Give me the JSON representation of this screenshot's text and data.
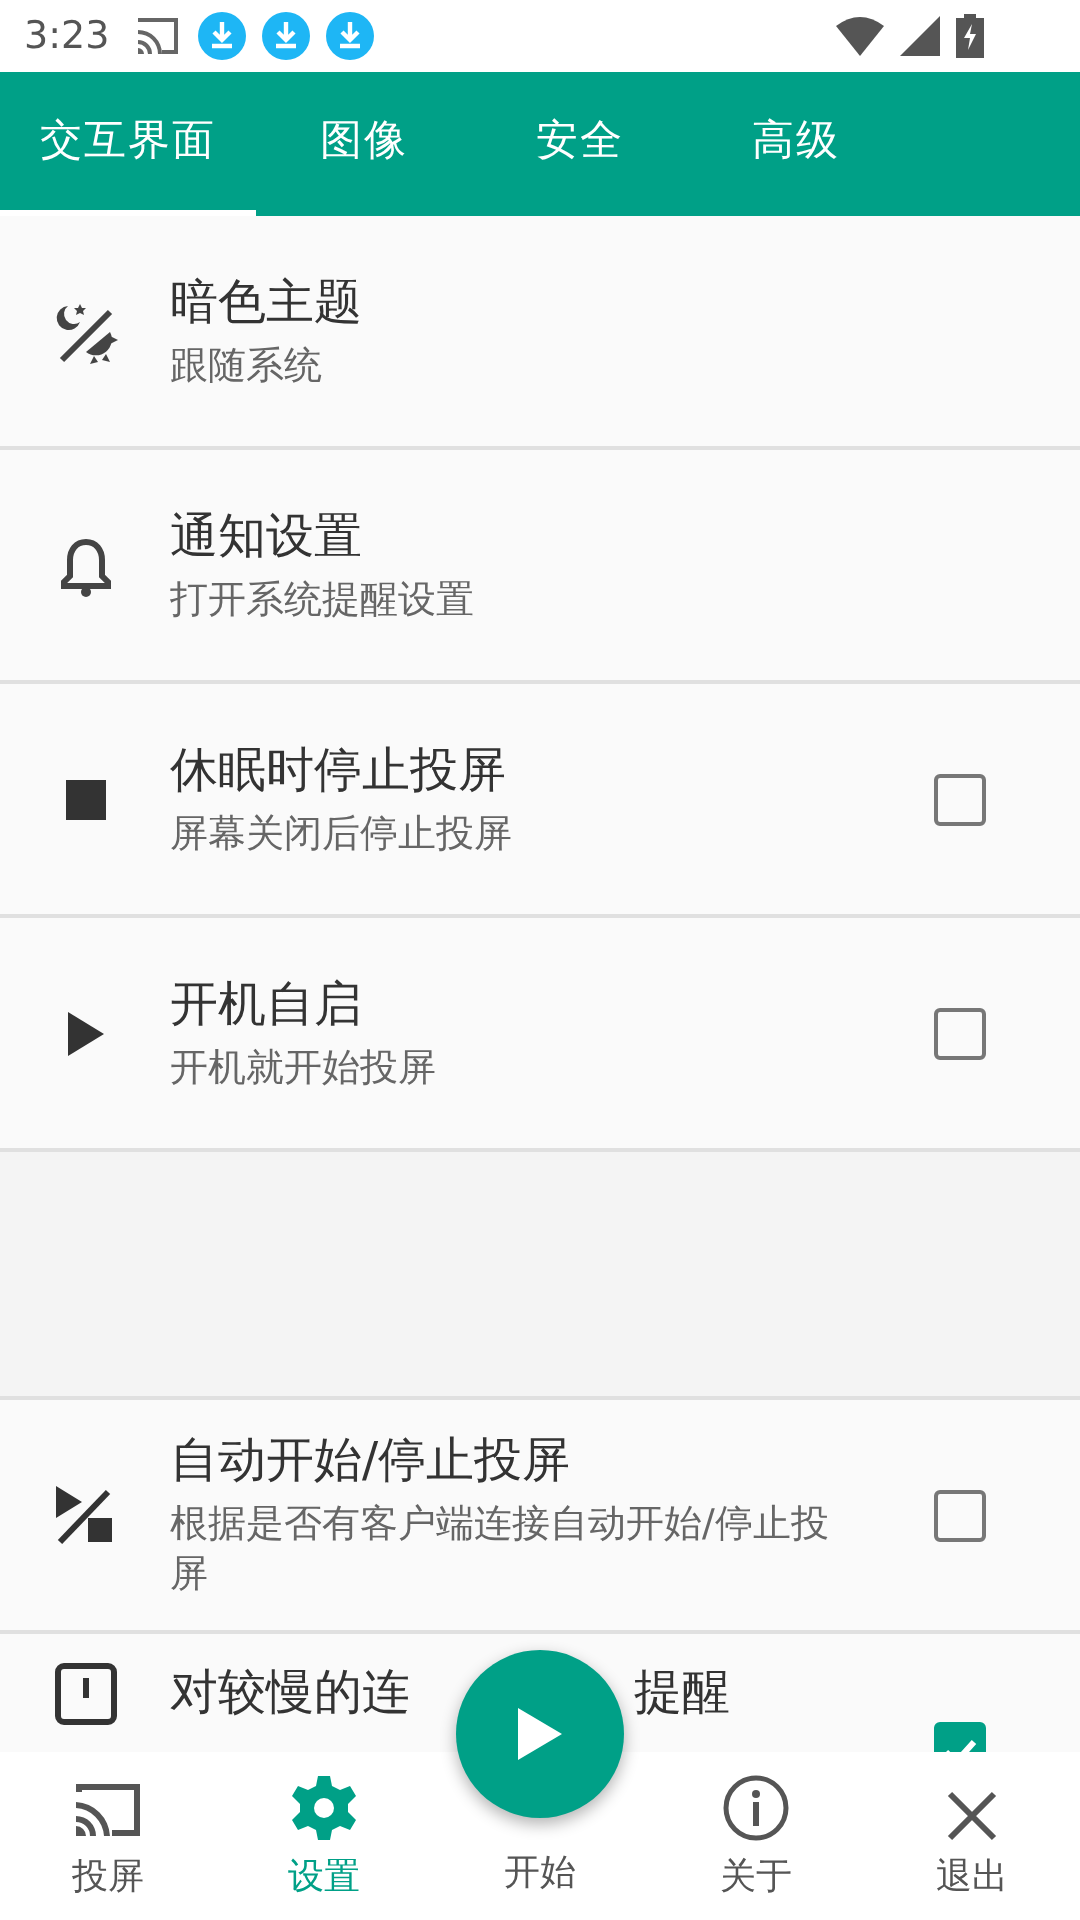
{
  "status_bar": {
    "time": "3:23"
  },
  "tabs": [
    {
      "label": "交互界面",
      "selected": true
    },
    {
      "label": "图像",
      "selected": false
    },
    {
      "label": "安全",
      "selected": false
    },
    {
      "label": "高级",
      "selected": false
    }
  ],
  "settings": [
    {
      "kind": "plain",
      "title": "暗色主题",
      "subtitle": "跟随系统"
    },
    {
      "kind": "plain",
      "title": "通知设置",
      "subtitle": "打开系统提醒设置"
    },
    {
      "kind": "checkbox",
      "title": "休眠时停止投屏",
      "subtitle": "屏幕关闭后停止投屏",
      "checked": false
    },
    {
      "kind": "checkbox",
      "title": "开机自启",
      "subtitle": "开机就开始投屏",
      "checked": false
    },
    {
      "kind": "spacer"
    },
    {
      "kind": "checkbox",
      "title": "自动开始/停止投屏",
      "subtitle": "根据是否有客户端连接自动开始/停止投屏",
      "checked": false
    },
    {
      "kind": "covered",
      "title": "对较慢的连",
      "title_end": "提醒",
      "checked": true
    }
  ],
  "bottom_nav": [
    {
      "kind": "tab",
      "label": "投屏",
      "selected": false
    },
    {
      "kind": "tab",
      "label": "设置",
      "selected": true
    },
    {
      "kind": "fab",
      "label": "开始"
    },
    {
      "kind": "tab",
      "label": "关于",
      "selected": false
    },
    {
      "kind": "tab",
      "label": "退出",
      "selected": false
    }
  ]
}
